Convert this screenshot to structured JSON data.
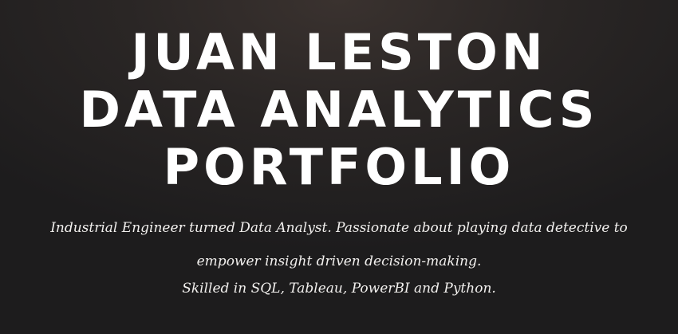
{
  "hero": {
    "title_lines": [
      "JUAN LESTON",
      "DATA ANALYTICS",
      "PORTFOLIO"
    ],
    "tagline_lines": [
      "Industrial Engineer turned Data Analyst. Passionate about playing data detective to",
      "empower insight driven decision-making.",
      "Skilled in SQL, Tableau, PowerBI and Python."
    ]
  },
  "colors": {
    "background_center": "#3a322f",
    "background_edge": "#1d1c1d",
    "text": "#ffffff"
  }
}
